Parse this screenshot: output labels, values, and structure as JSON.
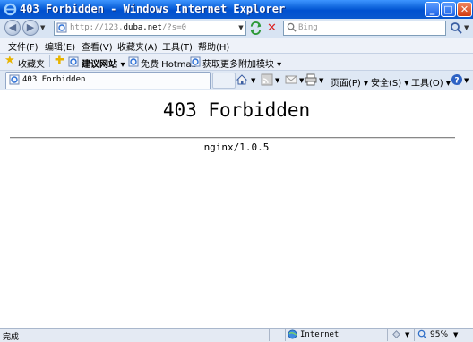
{
  "window": {
    "title": "403 Forbidden - Windows Internet Explorer",
    "min_glyph": "_",
    "max_glyph": "□",
    "close_glyph": "✕"
  },
  "address": {
    "prefix": "http://123.",
    "domain": "duba.net",
    "suffix": "/?s=0"
  },
  "search": {
    "placeholder": "Bing"
  },
  "menu": [
    "文件(F)",
    "编辑(E)",
    "查看(V)",
    "收藏夹(A)",
    "工具(T)",
    "帮助(H)"
  ],
  "favorites": {
    "label": "收藏夹",
    "items": [
      "建议网站 ▾",
      "免费 Hotmail",
      "获取更多附加模块 ▾"
    ]
  },
  "tab": {
    "label": "403 Forbidden"
  },
  "command_bar": {
    "page": "页面(P) ▾",
    "safety": "安全(S) ▾",
    "tools": "工具(O) ▾"
  },
  "page": {
    "heading": "403 Forbidden",
    "server": "nginx/1.0.5"
  },
  "status": {
    "text": "完成",
    "zone": "Internet",
    "zoom": "95%"
  },
  "colors": {
    "titlebar": "#0a5fd8",
    "accent": "#3d95ff",
    "close": "#d23c12"
  },
  "icons": [
    "ie-icon",
    "back-icon",
    "forward-icon",
    "refresh-icon",
    "stop-icon",
    "search-icon",
    "star-icon",
    "add-favorite-icon",
    "home-icon",
    "feeds-icon",
    "mail-icon",
    "print-icon",
    "help-icon",
    "globe-icon",
    "zoom-icon"
  ]
}
